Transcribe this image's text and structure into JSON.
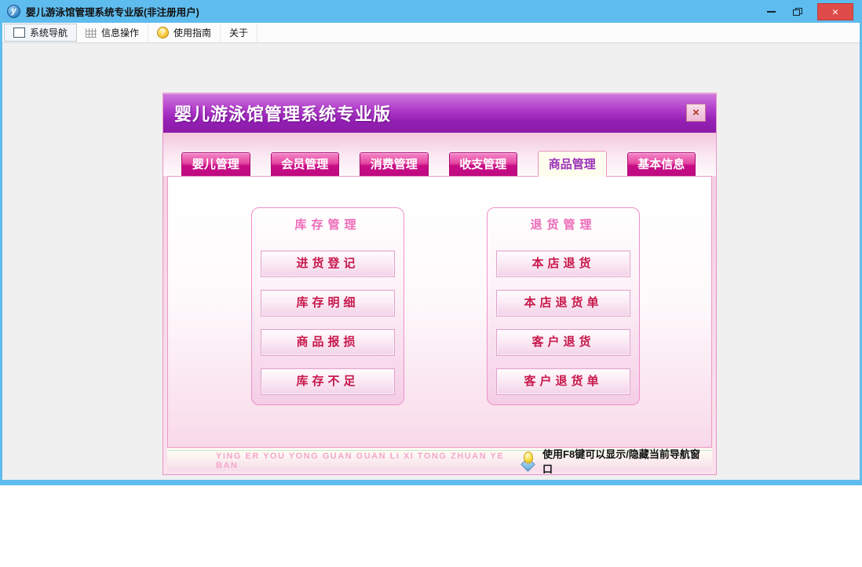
{
  "window": {
    "title": "婴儿游泳馆管理系统专业版(非注册用户)",
    "controls": {
      "close": "×"
    }
  },
  "icons": {
    "logo_glyph": "y",
    "help_glyph": "?"
  },
  "toolbar": {
    "items": [
      {
        "label": "系统导航",
        "icon": "navigation-icon"
      },
      {
        "label": "信息操作",
        "icon": "grid-icon"
      },
      {
        "label": "使用指南",
        "icon": "help-coin-icon"
      },
      {
        "label": "关于",
        "icon": ""
      }
    ]
  },
  "dialog": {
    "title": "婴儿游泳馆管理系统专业版",
    "close_label": "×",
    "tabs": [
      {
        "label": "婴儿管理",
        "active": false
      },
      {
        "label": "会员管理",
        "active": false
      },
      {
        "label": "消费管理",
        "active": false
      },
      {
        "label": "收支管理",
        "active": false
      },
      {
        "label": "商品管理",
        "active": true
      },
      {
        "label": "基本信息",
        "active": false
      }
    ],
    "groups": [
      {
        "title": "库存管理",
        "buttons": [
          "进货登记",
          "库存明细",
          "商品报损",
          "库存不足"
        ]
      },
      {
        "title": "退货管理",
        "buttons": [
          "本店退货",
          "本店退货单",
          "客户退货",
          "客户退货单"
        ]
      }
    ],
    "footer": {
      "slogan": "YING ER YOU YONG GUAN GUAN LI XI TONG ZHUAN YE BAN",
      "hint": "使用F8键可以显示/隐藏当前导航窗口"
    }
  },
  "colors": {
    "titlebar_blue": "#5FBCEE",
    "close_red": "#DE4B48",
    "header_purple": "#8A1CA8",
    "tab_magenta": "#C80D87",
    "active_tab_text": "#9A30B8",
    "group_title_pink": "#EC6CB8",
    "button_text_red": "#C8184B"
  }
}
